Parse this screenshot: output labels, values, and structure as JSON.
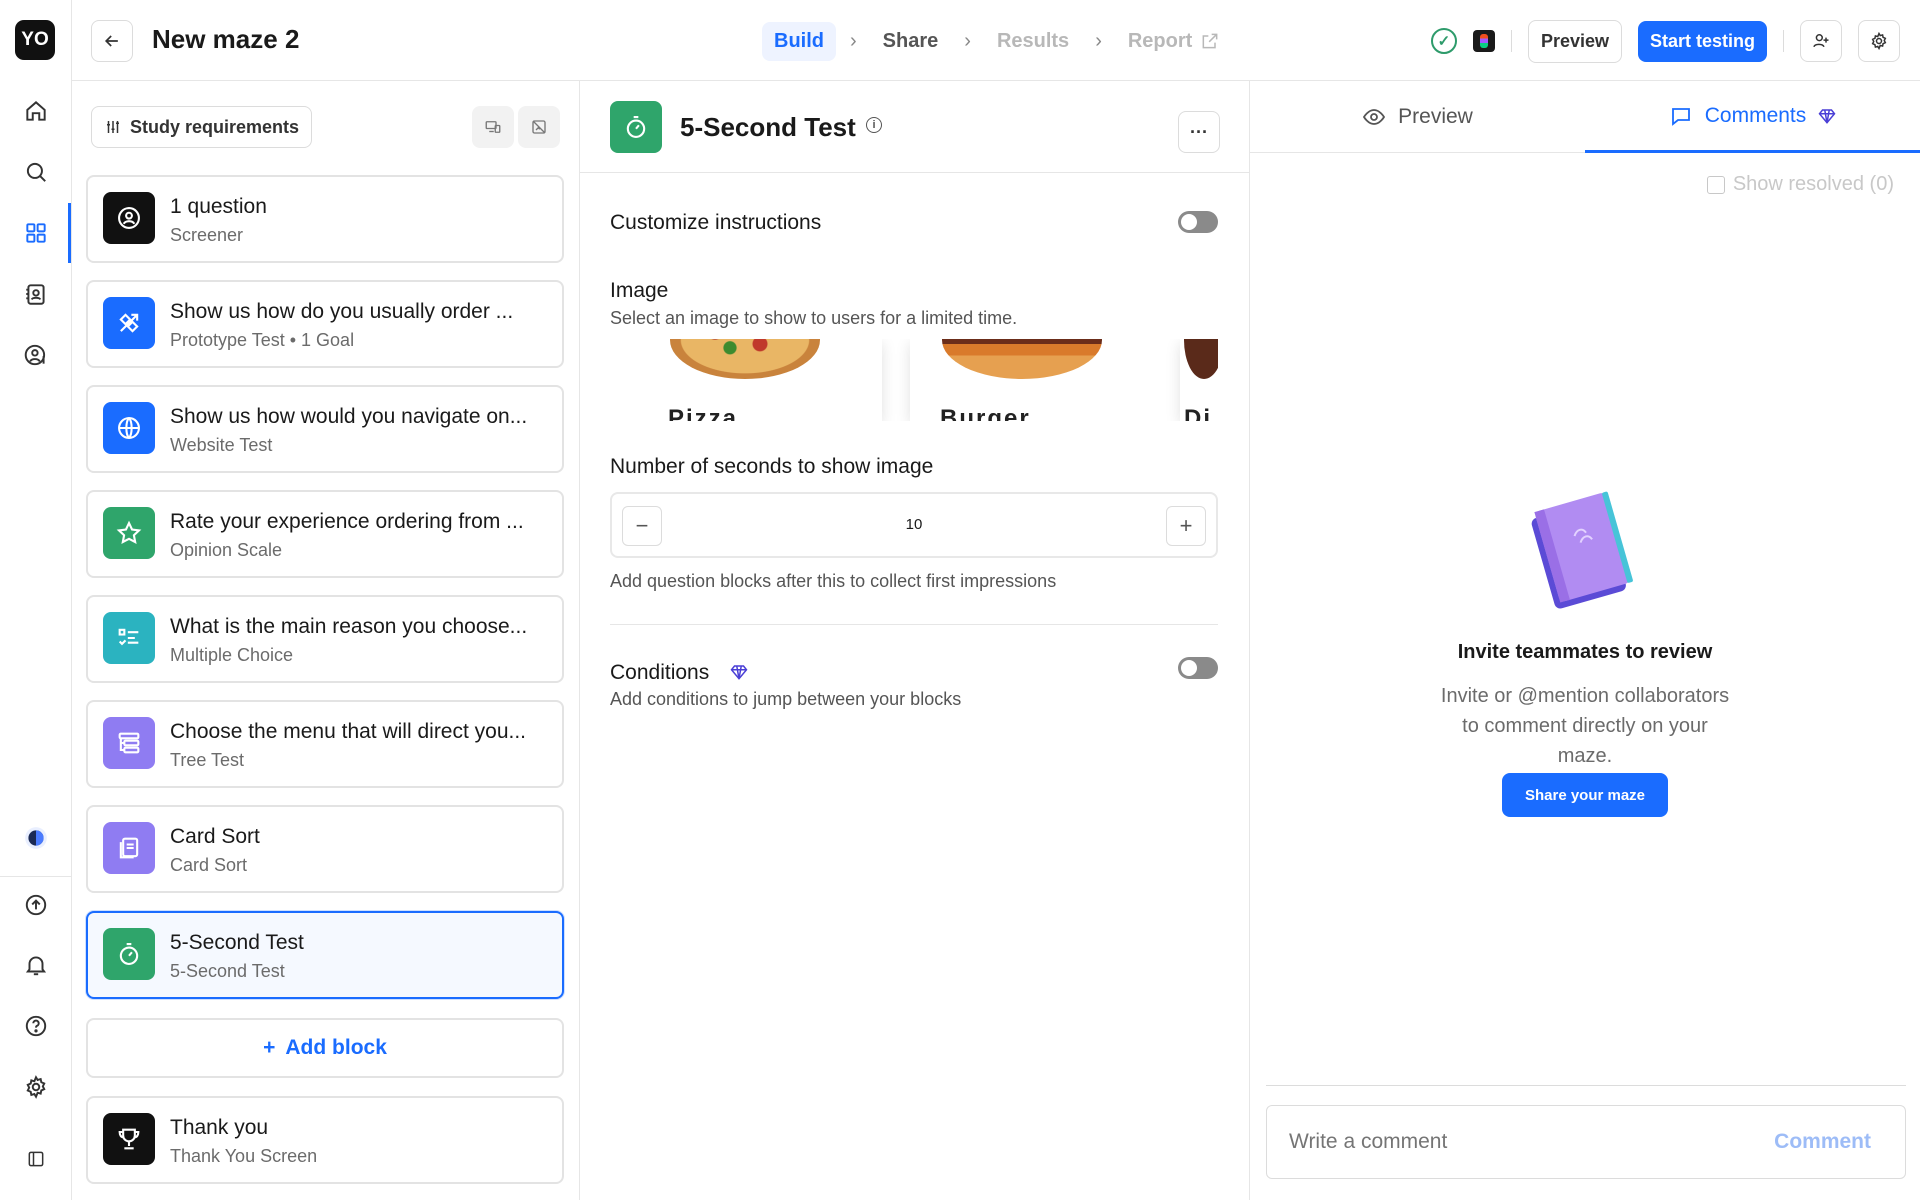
{
  "app": {
    "logo": "YO"
  },
  "rail": {
    "items": [
      {
        "icon": "home-icon"
      },
      {
        "icon": "search-icon"
      },
      {
        "icon": "grid-icon",
        "active": true
      },
      {
        "icon": "contacts-icon"
      },
      {
        "icon": "user-dollar-icon"
      },
      {
        "icon": "theme-icon"
      },
      {
        "icon": "upload-icon"
      },
      {
        "icon": "bell-icon"
      },
      {
        "icon": "help-icon"
      },
      {
        "icon": "gear-icon"
      },
      {
        "icon": "sidebar-toggle-icon"
      }
    ]
  },
  "header": {
    "title": "New maze 2",
    "steps": [
      {
        "label": "Build",
        "state": "active"
      },
      {
        "label": "Share",
        "state": "default"
      },
      {
        "label": "Results",
        "state": "muted"
      },
      {
        "label": "Report",
        "state": "muted"
      }
    ],
    "preview_label": "Preview",
    "start_label": "Start testing"
  },
  "blocks_panel": {
    "requirements_label": "Study requirements",
    "add_block_label": "Add block",
    "blocks": [
      {
        "title": "1 question",
        "subtitle": "Screener",
        "color": "#111111",
        "icon": "screener-icon"
      },
      {
        "title": "Show us how do you usually order ...",
        "subtitle": "Prototype Test • 1 Goal",
        "color": "#1a6cff",
        "icon": "prototype-icon"
      },
      {
        "title": "Show us how would you navigate on...",
        "subtitle": "Website Test",
        "color": "#1a6cff",
        "icon": "globe-icon"
      },
      {
        "title": "Rate your experience ordering from ...",
        "subtitle": "Opinion Scale",
        "color": "#2fa56b",
        "icon": "star-icon"
      },
      {
        "title": "What is the main reason you choose...",
        "subtitle": "Multiple Choice",
        "color": "#2bb3c0",
        "icon": "checklist-icon"
      },
      {
        "title": "Choose the menu that will direct you...",
        "subtitle": "Tree Test",
        "color": "#8f7cf2",
        "icon": "tree-icon"
      },
      {
        "title": "Card Sort",
        "subtitle": "Card Sort",
        "color": "#8f7cf2",
        "icon": "cards-icon"
      },
      {
        "title": "5-Second Test",
        "subtitle": "5-Second Test",
        "color": "#2fa56b",
        "icon": "timer-icon",
        "selected": true
      }
    ],
    "thank_you": {
      "title": "Thank you",
      "subtitle": "Thank You Screen",
      "color": "#111111",
      "icon": "trophy-icon"
    }
  },
  "editor": {
    "title": "5-Second Test",
    "customize_label": "Customize instructions",
    "image_label": "Image",
    "image_help": "Select an image to show to users for a limited time.",
    "image_cards": [
      "Pizza",
      "Burger",
      "Di"
    ],
    "seconds_label": "Number of seconds to show image",
    "seconds_value": "10",
    "seconds_help": "Add question blocks after this to collect first impressions",
    "conditions_label": "Conditions",
    "conditions_help": "Add conditions to jump between your blocks"
  },
  "comments": {
    "tabs": [
      {
        "label": "Preview",
        "active": false
      },
      {
        "label": "Comments",
        "active": true
      }
    ],
    "show_resolved": "Show resolved (0)",
    "invite_title": "Invite teammates to review",
    "invite_text": "Invite or @mention collaborators to comment directly on your maze.",
    "share_label": "Share your maze",
    "input_placeholder": "Write a comment",
    "submit_label": "Comment"
  },
  "colors": {
    "accent": "#1a6cff",
    "success": "#2e9b6b"
  }
}
